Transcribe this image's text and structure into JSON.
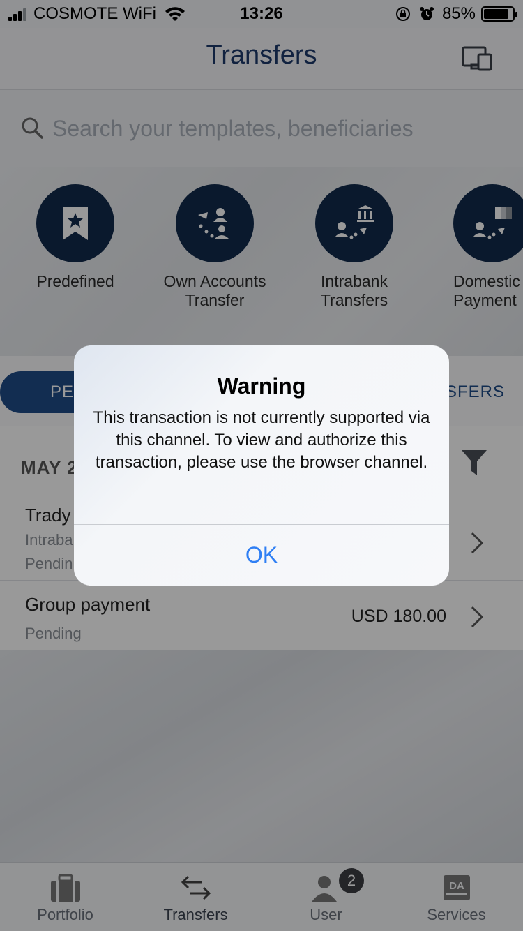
{
  "status_bar": {
    "carrier": "COSMOTE WiFi",
    "time": "13:26",
    "battery": "85%",
    "battery_level": 0.85
  },
  "header": {
    "title": "Transfers",
    "device_icon": "devices-icon"
  },
  "search": {
    "placeholder": "Search your templates, beneficiaries"
  },
  "actions": [
    {
      "label": "Predefined",
      "icon": "bookmark-star-icon"
    },
    {
      "label": "Own Accounts\nTransfer",
      "icon": "own-accounts-transfer-icon"
    },
    {
      "label": "Intrabank\nTransfers",
      "icon": "bank-transfer-icon"
    },
    {
      "label": "Domestic\nPayment",
      "icon": "domestic-payment-icon"
    }
  ],
  "tabs": {
    "active_partial": "PE",
    "other_partial": "ISFERS"
  },
  "list": {
    "section_header_partial": "MAY 2",
    "rows": [
      {
        "name": "Trady",
        "sub1": "Intraba",
        "sub2": "Pendin",
        "amount": ""
      },
      {
        "name": "Group payment",
        "sub1": "Pending",
        "amount": "USD 180.00"
      }
    ]
  },
  "tabbar": {
    "items": [
      {
        "label": "Portfolio",
        "icon": "briefcase-icon"
      },
      {
        "label": "Transfers",
        "icon": "transfer-arrows-icon"
      },
      {
        "label": "User",
        "icon": "user-icon",
        "badge": "2"
      },
      {
        "label": "Services",
        "icon": "services-da-icon",
        "icon_text": "DA"
      }
    ]
  },
  "dialog": {
    "title": "Warning",
    "message": "This transaction is not currently supported via this channel. To view and authorize this transaction, please use the browser channel.",
    "ok_label": "OK"
  },
  "colors": {
    "brand_navy": "#112a4c",
    "title_blue": "#1d3a6b",
    "ios_link_blue": "#2f7ff4"
  }
}
